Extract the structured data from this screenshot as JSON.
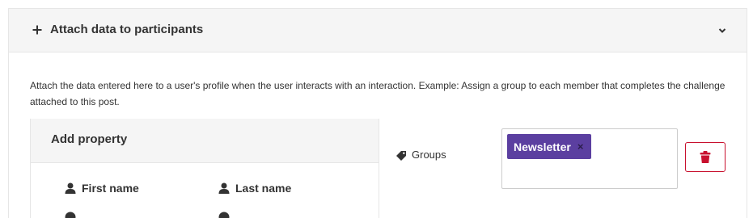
{
  "panel": {
    "title": "Attach data to participants",
    "description": "Attach the data entered here to a user's profile when the user interacts with an interaction. Example: Assign a group to each member that completes the challenge attached to this post."
  },
  "add_property": {
    "title": "Add property",
    "items": [
      "First name",
      "Last name",
      "",
      ""
    ]
  },
  "groups": {
    "label": "Groups",
    "tags": [
      "Newsletter"
    ],
    "tag_remove": "×"
  },
  "colors": {
    "tag_background": "#5b3fa0",
    "delete_accent": "#c8102e"
  }
}
